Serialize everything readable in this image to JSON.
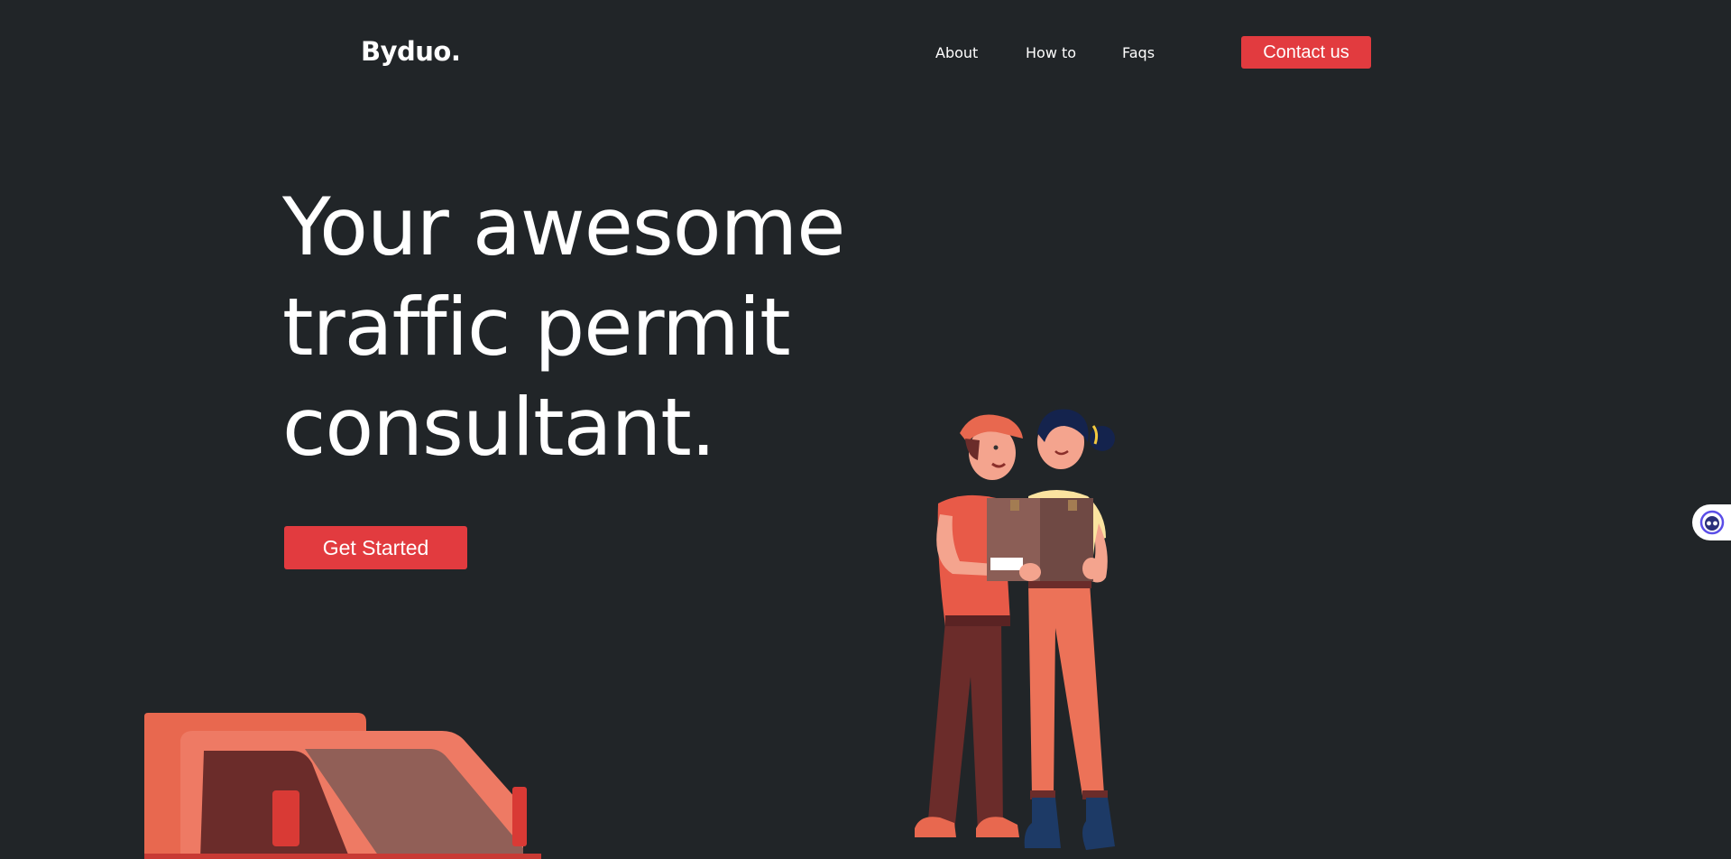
{
  "header": {
    "logo": "Byduo.",
    "nav": [
      {
        "label": "About"
      },
      {
        "label": "How to"
      },
      {
        "label": "Faqs"
      }
    ],
    "contact_label": "Contact us"
  },
  "hero": {
    "title_lines": [
      "Your awesome",
      "traffic permit",
      "consultant."
    ],
    "cta_label": "Get Started"
  },
  "widgets": {
    "chat_icon": "chat-bot-icon"
  },
  "colors": {
    "background": "#212528",
    "accent": "#e23b3f",
    "text": "#ffffff"
  }
}
